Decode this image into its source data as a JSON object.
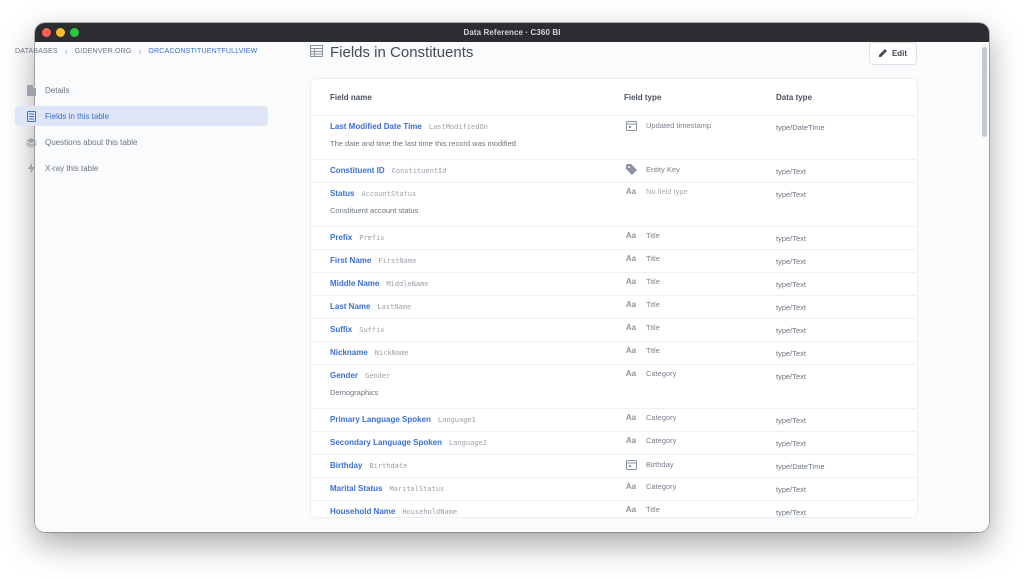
{
  "window": {
    "title": "Data Reference · C360 BI"
  },
  "breadcrumb": {
    "items": [
      "DATABASES",
      "GIDENVER.ORG",
      "ORCACONSTITUENTFULLVIEW"
    ]
  },
  "sidebar": {
    "items": [
      {
        "label": "Details",
        "icon": "document-icon",
        "active": false
      },
      {
        "label": "Fields in this table",
        "icon": "list-icon",
        "active": true
      },
      {
        "label": "Questions about this table",
        "icon": "layers-icon",
        "active": false
      },
      {
        "label": "X-ray this table",
        "icon": "bolt-icon",
        "active": false
      }
    ]
  },
  "page": {
    "title": "Fields in Constituents",
    "edit_label": "Edit"
  },
  "table": {
    "headers": {
      "field_name": "Field name",
      "field_type": "Field type",
      "data_type": "Data type"
    },
    "rows": [
      {
        "name": "Last Modified Date Time",
        "column": "LastModifiedOn",
        "description": "The date and time the last time this record was modified",
        "field_type": "Updated timestamp",
        "icon": "calendar-icon",
        "data_type": "type/DateTime"
      },
      {
        "name": "Constituent ID",
        "column": "ConstituentId",
        "description": "",
        "field_type": "Entity Key",
        "icon": "tag-icon",
        "data_type": "type/Text"
      },
      {
        "name": "Status",
        "column": "AccountStatus",
        "description": "Constituent account status",
        "field_type": "No field type",
        "icon": "text-icon",
        "data_type": "type/Text",
        "empty": true
      },
      {
        "name": "Prefix",
        "column": "Prefix",
        "description": "",
        "field_type": "Title",
        "icon": "text-icon",
        "data_type": "type/Text"
      },
      {
        "name": "First Name",
        "column": "FirstName",
        "description": "",
        "field_type": "Title",
        "icon": "text-icon",
        "data_type": "type/Text"
      },
      {
        "name": "Middle Name",
        "column": "MiddleName",
        "description": "",
        "field_type": "Title",
        "icon": "text-icon",
        "data_type": "type/Text"
      },
      {
        "name": "Last Name",
        "column": "LastName",
        "description": "",
        "field_type": "Title",
        "icon": "text-icon",
        "data_type": "type/Text"
      },
      {
        "name": "Suffix",
        "column": "Suffix",
        "description": "",
        "field_type": "Title",
        "icon": "text-icon",
        "data_type": "type/Text"
      },
      {
        "name": "Nickname",
        "column": "NickName",
        "description": "",
        "field_type": "Title",
        "icon": "text-icon",
        "data_type": "type/Text"
      },
      {
        "name": "Gender",
        "column": "Gender",
        "description": "Demographics",
        "field_type": "Category",
        "icon": "text-icon",
        "data_type": "type/Text"
      },
      {
        "name": "Primary Language Spoken",
        "column": "Language1",
        "description": "",
        "field_type": "Category",
        "icon": "text-icon",
        "data_type": "type/Text"
      },
      {
        "name": "Secondary Language Spoken",
        "column": "Language2",
        "description": "",
        "field_type": "Category",
        "icon": "text-icon",
        "data_type": "type/Text"
      },
      {
        "name": "Birthday",
        "column": "Birthdate",
        "description": "",
        "field_type": "Birthday",
        "icon": "calendar-icon",
        "data_type": "type/DateTime"
      },
      {
        "name": "Marital Status",
        "column": "MaritalStatus",
        "description": "",
        "field_type": "Category",
        "icon": "text-icon",
        "data_type": "type/Text"
      },
      {
        "name": "Household Name",
        "column": "HouseholdName",
        "description": "",
        "field_type": "Title",
        "icon": "text-icon",
        "data_type": "type/Text"
      }
    ]
  },
  "colors": {
    "accent": "#3b6fd6",
    "active_bg": "#dde5f6",
    "titlebar": "#2c2d30"
  },
  "icons": {
    "text": "Aa"
  }
}
